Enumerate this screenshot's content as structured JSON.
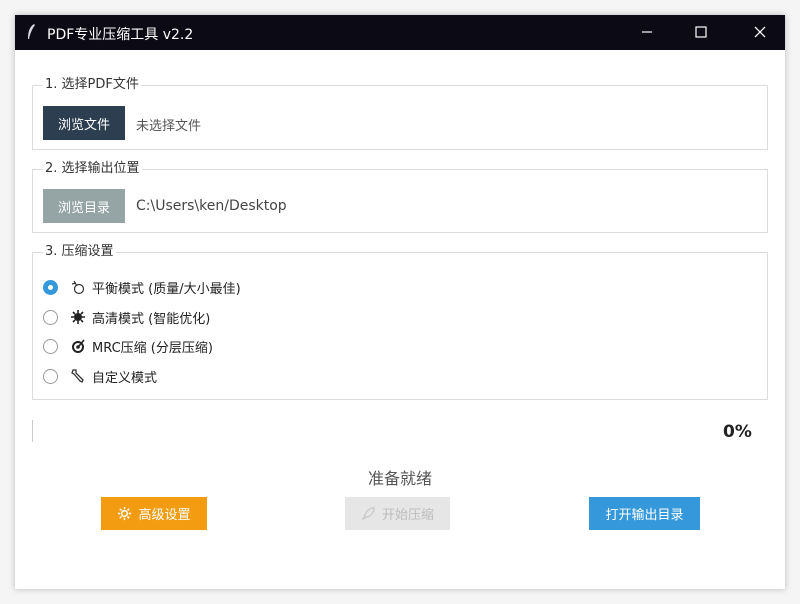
{
  "window": {
    "title": "PDF专业压缩工具 v2.2"
  },
  "titlebar_icons": [
    "feather-icon",
    "minimize-icon",
    "maximize-icon",
    "close-icon"
  ],
  "section_file": {
    "title": "1. 选择PDF文件",
    "button": "浏览文件",
    "value": "未选择文件"
  },
  "section_output": {
    "title": "2. 选择输出位置",
    "button": "浏览目录",
    "value": "C:\\Users\\ken/Desktop"
  },
  "section_settings": {
    "title": "3. 压缩设置",
    "options": [
      {
        "label": "平衡模式 (质量/大小最佳)",
        "icon": "balance-icon",
        "checked": true
      },
      {
        "label": "高清模式 (智能优化)",
        "icon": "gear-sparkle-icon",
        "checked": false
      },
      {
        "label": "MRC压缩 (分层压缩)",
        "icon": "layers-icon",
        "checked": false
      },
      {
        "label": "自定义模式",
        "icon": "wrench-icon",
        "checked": false
      }
    ]
  },
  "progress": {
    "value": 0,
    "text": "0%"
  },
  "status": "准备就绪",
  "actions": {
    "advanced": "高级设置",
    "start": "开始压缩",
    "open_output": "打开输出目录"
  },
  "colors": {
    "titlebar": "#0c0a14",
    "dark_button": "#2c3e50",
    "gray_button": "#95a5a6",
    "accent_blue": "#3498db",
    "orange": "#f39c12",
    "disabled": "#e6e6e6"
  }
}
